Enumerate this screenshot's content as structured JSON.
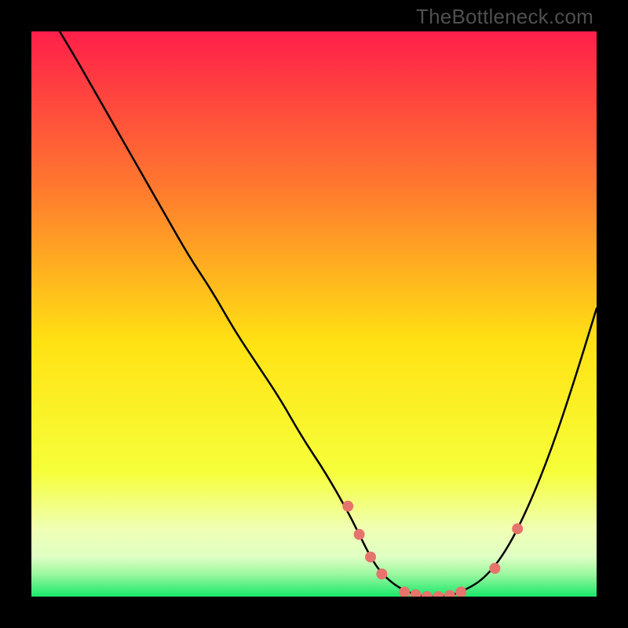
{
  "watermark": "TheBottleneck.com",
  "colors": {
    "top": "#ff1f4a",
    "mid_upper": "#ff8b2a",
    "mid": "#ffe213",
    "mid_lower": "#f6ff3a",
    "pale": "#f0ffb4",
    "pale2": "#dfffc4",
    "green": "#19e86a",
    "curve": "#000000",
    "dots": "#e5746c"
  },
  "chart_data": {
    "type": "line",
    "title": "",
    "xlabel": "",
    "ylabel": "",
    "xlim": [
      0,
      100
    ],
    "ylim": [
      0,
      100
    ],
    "x": [
      5,
      8,
      12,
      16,
      20,
      24,
      28,
      32,
      36,
      40,
      44,
      48,
      52,
      56,
      58,
      60,
      62,
      65,
      68,
      70,
      72,
      74,
      76,
      80,
      84,
      88,
      92,
      96,
      100
    ],
    "values": [
      100,
      95,
      88,
      81,
      74,
      67,
      60,
      54,
      47,
      41,
      35,
      28,
      22,
      15,
      11,
      7,
      4,
      1.5,
      0.3,
      0,
      0,
      0.2,
      0.8,
      3,
      8,
      16,
      26,
      38,
      51
    ],
    "dots": [
      {
        "x": 56,
        "y": 16
      },
      {
        "x": 58,
        "y": 11
      },
      {
        "x": 60,
        "y": 7
      },
      {
        "x": 62,
        "y": 4
      },
      {
        "x": 66,
        "y": 0.8
      },
      {
        "x": 68,
        "y": 0.3
      },
      {
        "x": 70,
        "y": 0
      },
      {
        "x": 72,
        "y": 0
      },
      {
        "x": 74,
        "y": 0.2
      },
      {
        "x": 76,
        "y": 0.8
      },
      {
        "x": 82,
        "y": 5
      },
      {
        "x": 86,
        "y": 12
      }
    ]
  }
}
